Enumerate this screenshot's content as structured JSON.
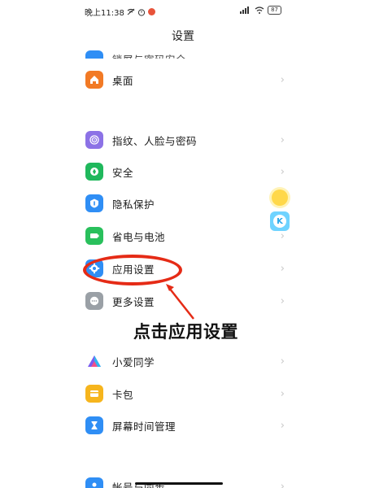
{
  "status_bar": {
    "time": "晚上11:38",
    "battery": "87"
  },
  "header": {
    "title": "设置"
  },
  "settings": {
    "partial_top_label": "锁屏与密码安全",
    "desktop": "桌面",
    "fingerprint": "指纹、人脸与密码",
    "security": "安全",
    "privacy": "隐私保护",
    "battery": "省电与电池",
    "app_settings": "应用设置",
    "more_settings": "更多设置",
    "xiaoai": "小爱同学",
    "card": "卡包",
    "screen_time": "屏幕时间管理",
    "account": "帐号与同步"
  },
  "annotation": {
    "text": "点击应用设置"
  },
  "colors": {
    "annotation_red": "#e52b16",
    "accent_blue": "#2f8ef5"
  },
  "icons": [
    "home-icon",
    "fingerprint-icon",
    "shield-icon",
    "privacy-icon",
    "battery-icon",
    "gear-icon",
    "more-icon",
    "xiaoai-icon",
    "card-icon",
    "hourglass-icon",
    "account-icon"
  ]
}
